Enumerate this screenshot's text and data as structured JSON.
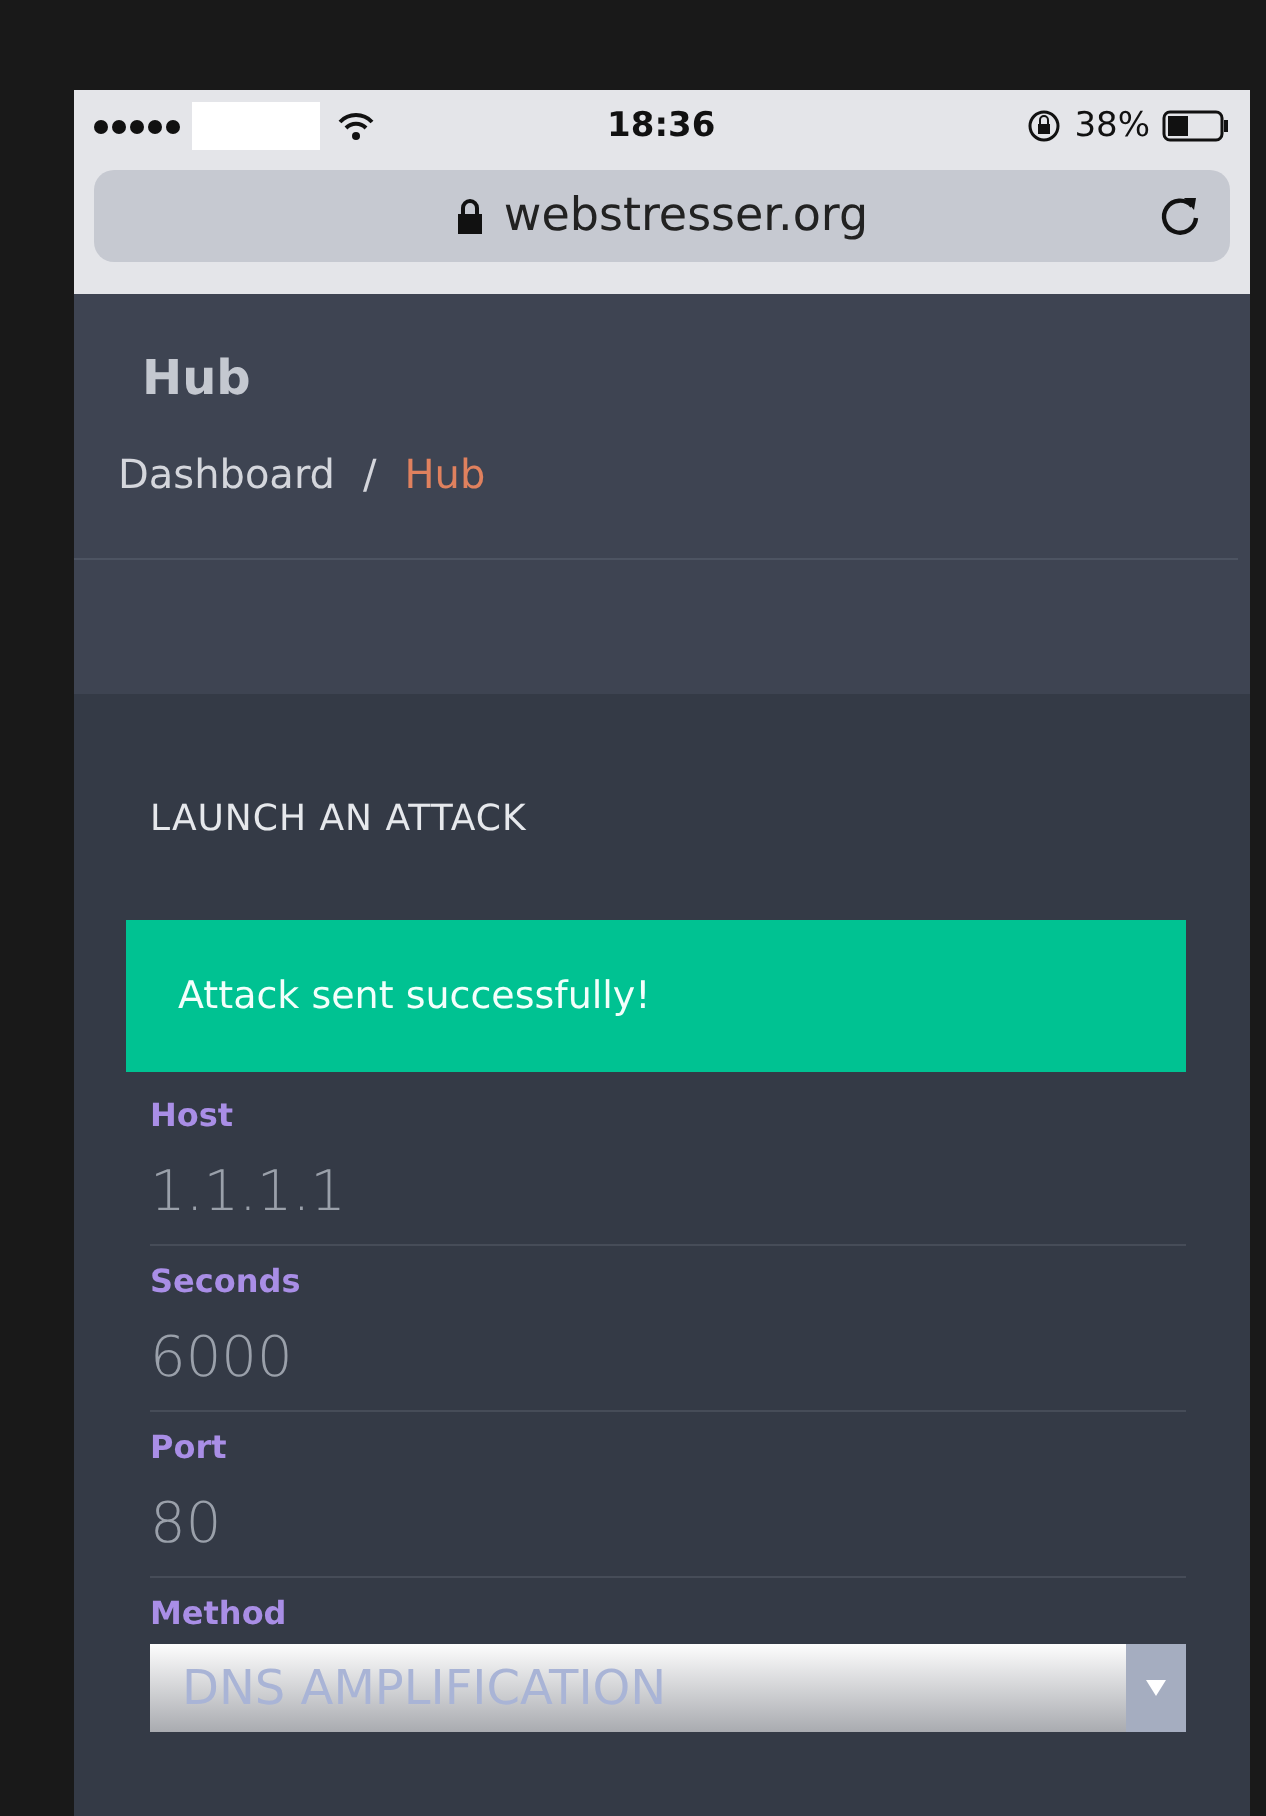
{
  "status_bar": {
    "time": "18:36",
    "battery": "38%"
  },
  "address_bar": {
    "url": "webstresser.org"
  },
  "header": {
    "title": "Hub",
    "breadcrumb": [
      {
        "label": "Dashboard",
        "selected": false
      },
      {
        "label": "Hub",
        "selected": true
      }
    ],
    "separator": "/"
  },
  "panel": {
    "title": "LAUNCH AN ATTACK",
    "alert": "Attack sent successfully!",
    "fields": [
      {
        "kind": "input",
        "label": "Host",
        "value": "1.1.1.1"
      },
      {
        "kind": "input",
        "label": "Seconds",
        "value": "6000"
      },
      {
        "kind": "input",
        "label": "Port",
        "value": "80"
      },
      {
        "kind": "select",
        "label": "Method",
        "value": "DNS AMPLIFICATION"
      }
    ]
  }
}
